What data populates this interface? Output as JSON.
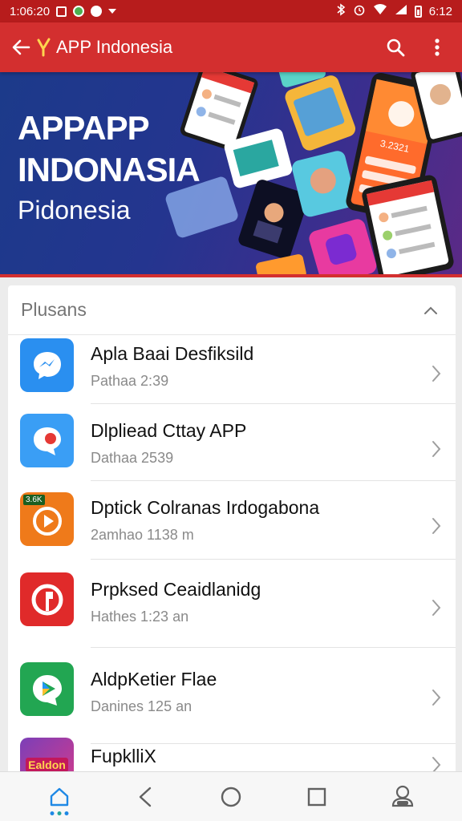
{
  "status_bar": {
    "time_left": "1:06:20",
    "time_right": "6:12"
  },
  "app_bar": {
    "title": "APP Indonesia"
  },
  "banner": {
    "line1": "APPAPP",
    "line2": "INDONASIA",
    "line3": "Pidonesia",
    "badge_text": "3.2321"
  },
  "section": {
    "title": "Plusans"
  },
  "apps": [
    {
      "title": "Apla Baai Desfiksild",
      "subtitle": "Pathaa 2:39",
      "icon": "messenger-icon",
      "color": "#2a8ff0"
    },
    {
      "title": "Dlpliead Cttay APP",
      "subtitle": "Dathaa 2539",
      "icon": "chat-bubble-icon",
      "color": "#3a9ef5"
    },
    {
      "title": "Dptick Colranas Irdogabona",
      "subtitle": "2amhao 1138 m",
      "icon": "play-icon",
      "color": "#ef7a1a",
      "badge": "3.6K"
    },
    {
      "title": "Prpksed Ceaidlanidg",
      "subtitle": "Hathes 1:23 an",
      "icon": "music-icon",
      "color": "#e02a2a"
    },
    {
      "title": "AldpKetier Flae",
      "subtitle": "Danines 125 an",
      "icon": "play-store-icon",
      "color": "#22a652"
    },
    {
      "title": "FupklliX",
      "subtitle": "",
      "icon": "video-app-icon",
      "color": "#7b3fb8",
      "badge": "Ealdon"
    }
  ],
  "colors": {
    "primary": "#d32f2f",
    "primary_dark": "#b71c1c",
    "accent": "#1e88e5"
  }
}
